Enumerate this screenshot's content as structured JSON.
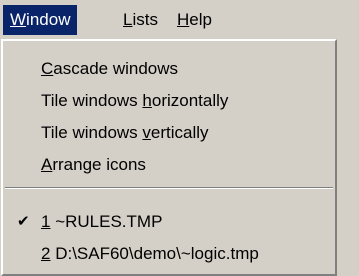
{
  "menubar": {
    "items": [
      {
        "accel": "W",
        "rest": "indow"
      },
      {
        "accel": "L",
        "rest": "ists"
      },
      {
        "accel": "H",
        "rest": "elp"
      }
    ]
  },
  "window_menu": {
    "items": [
      {
        "pre": "",
        "accel": "C",
        "post": "ascade windows"
      },
      {
        "pre": "Tile windows ",
        "accel": "h",
        "post": "orizontally"
      },
      {
        "pre": "Tile windows ",
        "accel": "v",
        "post": "ertically"
      },
      {
        "pre": "",
        "accel": "A",
        "post": "rrange icons"
      }
    ],
    "open_windows": [
      {
        "number": "1",
        "name": " ~RULES.TMP",
        "checked": true
      },
      {
        "number": "2",
        "name": " D:\\SAF60\\demo\\~logic.tmp",
        "checked": false
      }
    ],
    "check_glyph": "✔",
    "check_icon": "checkmark-icon"
  }
}
